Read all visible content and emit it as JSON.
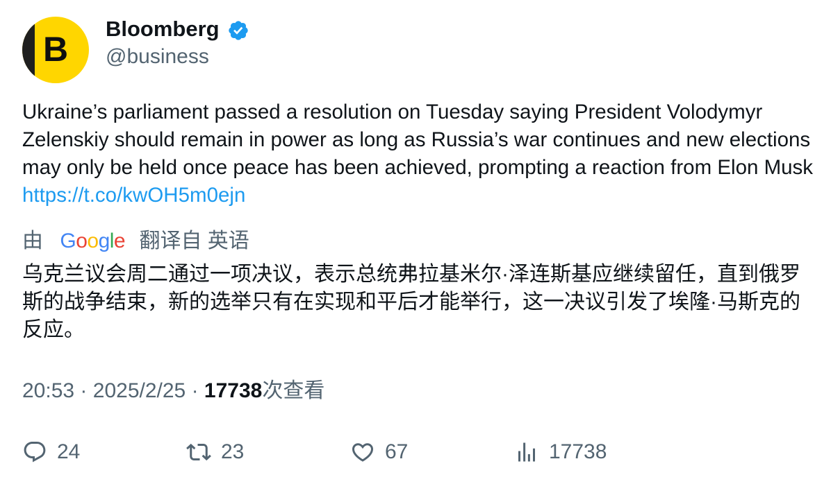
{
  "author": {
    "avatar_letter": "B",
    "name": "Bloomberg",
    "handle": "@business"
  },
  "tweet": {
    "text": "Ukraine’s parliament passed a resolution on Tuesday saying President Volodymyr Zelenskiy should remain in power as long as Russia’s war continues and new elections may only be held once peace has been achieved, prompting a reaction from Elon Musk ",
    "link": "https://t.co/kwOH5m0ejn"
  },
  "translation": {
    "by_label": "由",
    "google_letters": [
      "G",
      "o",
      "o",
      "g",
      "l",
      "e"
    ],
    "from_label": "翻译自 英语",
    "text": "乌克兰议会周二通过一项决议，表示总统弗拉基米尔·泽连斯基应继续留任，直到俄罗斯的战争结束，新的选举只有在实现和平后才能举行，这一决议引发了埃隆·马斯克的反应。"
  },
  "meta": {
    "time": "20:53",
    "separator": "·",
    "date": "2025/2/25",
    "views_count": "17738",
    "views_label": "次查看"
  },
  "actions": {
    "replies": "24",
    "retweets": "23",
    "likes": "67",
    "views": "17738"
  },
  "colors": {
    "accent": "#1d9bf0",
    "secondary_text": "#536471",
    "avatar_bg": "#ffd600"
  }
}
